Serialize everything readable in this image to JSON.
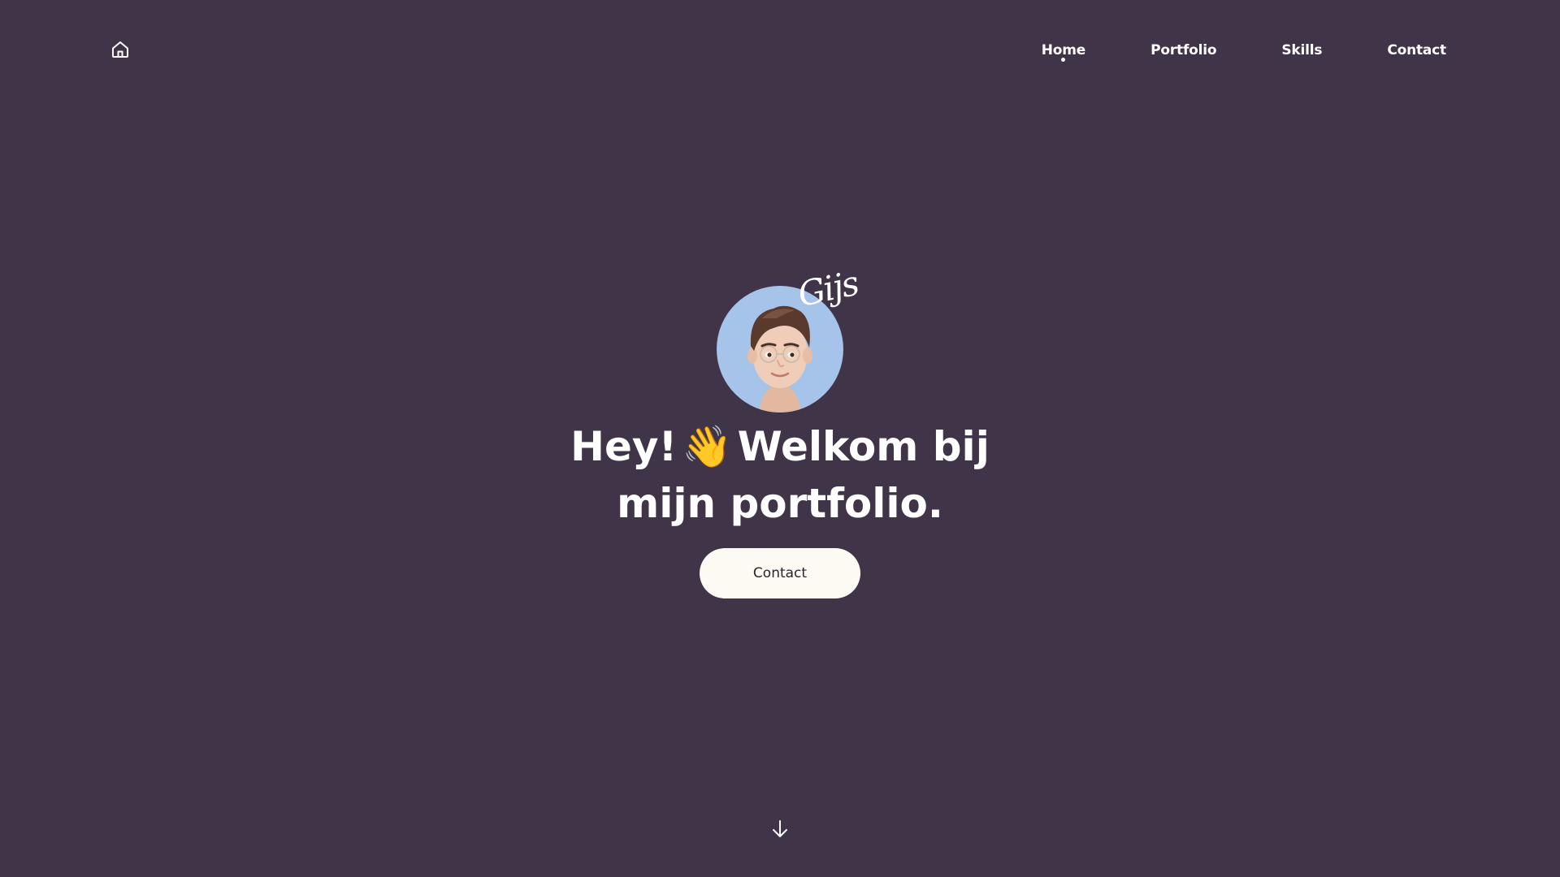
{
  "header": {
    "home_icon": "home-icon",
    "nav": [
      {
        "label": "Home",
        "active": true
      },
      {
        "label": "Portfolio",
        "active": false
      },
      {
        "label": "Skills",
        "active": false
      },
      {
        "label": "Contact",
        "active": false
      }
    ]
  },
  "hero": {
    "avatar_icon": "memoji-avatar",
    "signature": "Gijs",
    "heading_line1_before": "Hey!",
    "wave_emoji": "👋",
    "heading_line1_after": "Welkom bij",
    "heading_line2": "mijn portfolio.",
    "button_label": "Contact"
  },
  "scroll_icon": "arrow-down-icon",
  "colors": {
    "background": "#3f3448",
    "avatar_bg": "#a6c4ea",
    "button_bg": "#fdf9f3",
    "text": "#ffffff"
  }
}
